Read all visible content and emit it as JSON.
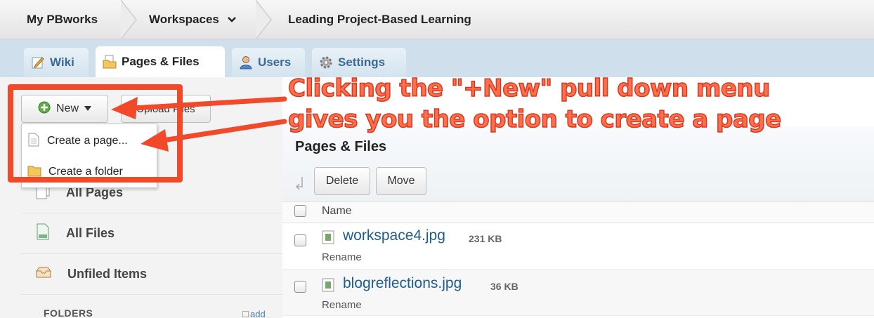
{
  "breadcrumb": {
    "home": "My PBworks",
    "workspaces": "Workspaces",
    "workspace_name": "Leading Project-Based Learning"
  },
  "tabs": [
    {
      "label": "Wiki",
      "icon": "pencil-icon"
    },
    {
      "label": "Pages & Files",
      "icon": "folder-page-icon",
      "active": true
    },
    {
      "label": "Users",
      "icon": "user-icon"
    },
    {
      "label": "Settings",
      "icon": "gear-icon"
    }
  ],
  "toolbar": {
    "new_label": "New",
    "upload_label": "Upload Files"
  },
  "dropdown": {
    "create_page": "Create a page...",
    "create_folder": "Create a folder"
  },
  "sidebar": {
    "items": [
      {
        "label": "All Pages",
        "icon": "pages-icon"
      },
      {
        "label": "All Files",
        "icon": "file-icon"
      },
      {
        "label": "Unfiled Items",
        "icon": "inbox-icon"
      }
    ],
    "folders_header": "FOLDERS",
    "add_label": "add"
  },
  "main": {
    "title": "Pages & Files",
    "delete_label": "Delete",
    "move_label": "Move",
    "column_name": "Name",
    "files": [
      {
        "name": "workspace4.jpg",
        "size": "231 KB",
        "action": "Rename"
      },
      {
        "name": "blogreflections.jpg",
        "size": "36 KB",
        "action": "Rename"
      }
    ]
  },
  "annotation": {
    "line1": "Clicking the \"+New\" pull down menu",
    "line2": "gives you the option to create a page",
    "color": "#f2492a"
  }
}
